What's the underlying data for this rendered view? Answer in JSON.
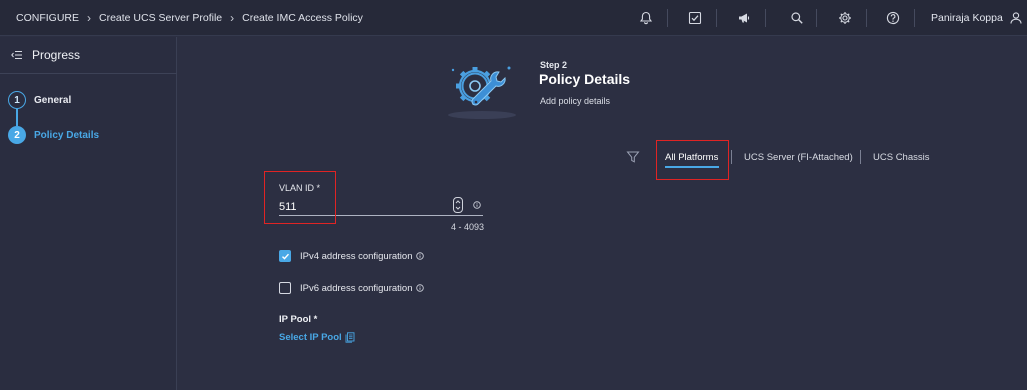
{
  "breadcrumb": [
    "CONFIGURE",
    "Create UCS Server Profile",
    "Create IMC Access Policy"
  ],
  "topbar_icons": [
    "bell-icon",
    "checklist-icon",
    "megaphone-icon",
    "search-icon",
    "gear-icon",
    "help-icon"
  ],
  "user": {
    "name": "Paniraja Koppa",
    "icon": "user-icon"
  },
  "sidebar": {
    "title": "Progress",
    "steps": [
      {
        "number": "1",
        "label": "General",
        "state": "completed"
      },
      {
        "number": "2",
        "label": "Policy Details",
        "state": "active"
      }
    ]
  },
  "step_header": {
    "step": "Step 2",
    "title": "Policy Details",
    "description": "Add policy details"
  },
  "platform_tabs": {
    "items": [
      "All Platforms",
      "UCS Server (FI-Attached)",
      "UCS Chassis"
    ],
    "selected": "All Platforms"
  },
  "form": {
    "vlan": {
      "label": "VLAN ID *",
      "value": "511",
      "range": "4 - 4093"
    },
    "ipv4": {
      "label": "IPv4 address configuration",
      "checked": true
    },
    "ipv6": {
      "label": "IPv6 address configuration",
      "checked": false
    },
    "ip_pool": {
      "label": "IP Pool *",
      "link": "Select IP Pool"
    }
  },
  "colors": {
    "background": "#2c2f42",
    "topbar": "#262939",
    "accent": "#49a8e6",
    "highlight_box": "#e02424"
  }
}
